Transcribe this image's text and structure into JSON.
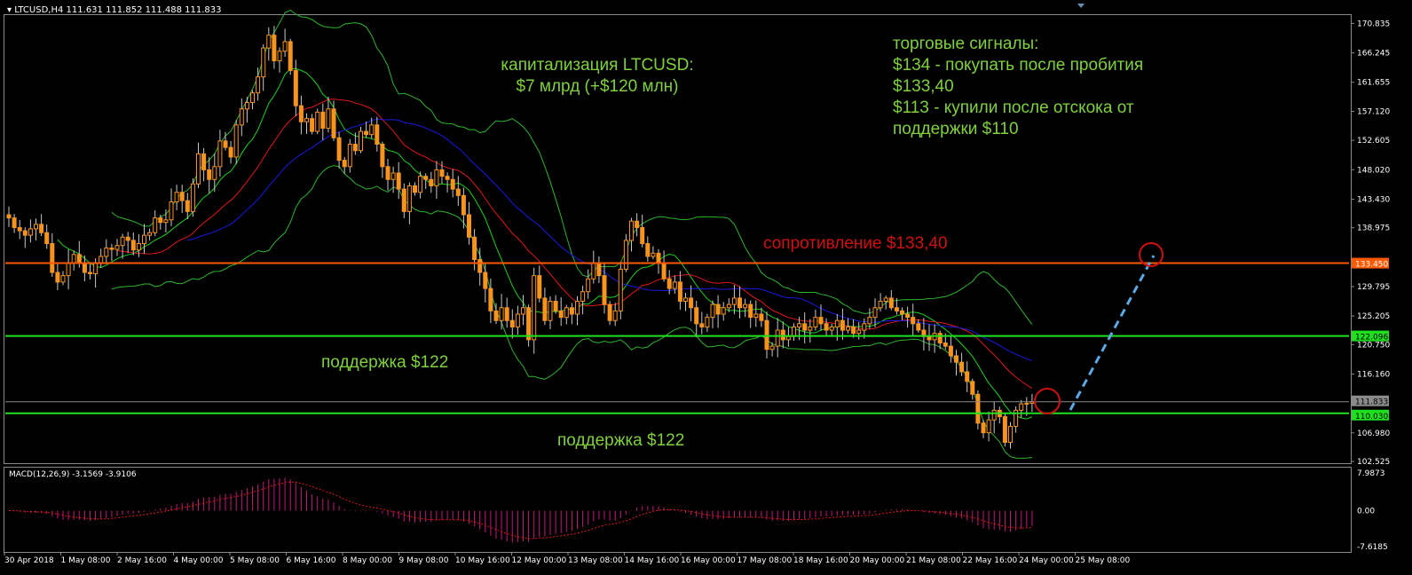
{
  "header": {
    "symbol": "LTCUSD,H4",
    "ohlc": "111.631 111.852 111.488 111.833"
  },
  "macd": {
    "label": "MACD(12,26,9) -3.1569 -3.9106",
    "axis": [
      "7.9873",
      "0.00",
      "-7.6185"
    ]
  },
  "annotations": {
    "cap_line1": "капитализация LTCUSD:",
    "cap_line2": "$7 млрд (+$120 млн)",
    "signals_title": "торговые сигналы:",
    "signal_1": "$134 - покупать после пробития",
    "signal_2": "$133,40",
    "signal_3": "$113 - купили после отскока от",
    "signal_4": "поддержки $110",
    "resistance": "сопротивление $133,40",
    "support_upper": "поддержка $122",
    "support_lower": "поддержка $122"
  },
  "colors": {
    "bull": "#f7941d",
    "bear": "#f7941d",
    "bollinger": "#2db52d",
    "ma_fast": "#1ad11a",
    "ma_mid": "#e01818",
    "ma_slow": "#1a1ae0",
    "resistance": "#ff5a00",
    "support": "#1fe01f",
    "macd_hist": "#c2187a",
    "macd_signal": "#e01818"
  },
  "chart_data": {
    "type": "candlestick",
    "symbol": "LTCUSD",
    "timeframe": "H4",
    "ylim": [
      102.525,
      172.0
    ],
    "y_ticks": [
      "170.835",
      "166.245",
      "161.655",
      "157.120",
      "152.605",
      "148.020",
      "143.430",
      "138.975",
      "129.795",
      "125.205",
      "120.750",
      "116.160",
      "106.980",
      "102.525"
    ],
    "x_ticks": [
      "30 Apr 2018",
      "1 May 08:00",
      "2 May 16:00",
      "4 May 00:00",
      "5 May 08:00",
      "6 May 16:00",
      "8 May 00:00",
      "9 May 08:00",
      "10 May 16:00",
      "12 May 00:00",
      "13 May 08:00",
      "14 May 16:00",
      "16 May 00:00",
      "17 May 08:00",
      "18 May 16:00",
      "20 May 00:00",
      "21 May 08:00",
      "22 May 16:00",
      "24 May 00:00",
      "25 May 08:00"
    ],
    "price_lines": [
      {
        "name": "resistance",
        "value": 133.45,
        "label": "133.450"
      },
      {
        "name": "support_upper",
        "value": 122.096,
        "label": "122.096"
      },
      {
        "name": "current",
        "value": 111.833,
        "label": "111.833"
      },
      {
        "name": "support_lower",
        "value": 110.03,
        "label": "110.030"
      }
    ],
    "close": [
      140.5,
      139.0,
      138.5,
      137.8,
      138.8,
      139.5,
      138.2,
      136.5,
      132.0,
      130.5,
      131.5,
      133.5,
      134.8,
      133.5,
      132.0,
      131.8,
      133.5,
      134.5,
      135.8,
      135.6,
      136.2,
      137.5,
      137.0,
      135.5,
      136.5,
      137.8,
      138.2,
      140.5,
      139.8,
      140.2,
      143.0,
      144.5,
      143.2,
      141.5,
      145.8,
      150.5,
      148.0,
      146.5,
      148.5,
      152.5,
      151.5,
      150.0,
      155.0,
      157.5,
      158.5,
      160.0,
      162.5,
      167.0,
      169.0,
      165.0,
      166.5,
      168.0,
      163.5,
      158.0,
      155.5,
      156.0,
      154.0,
      157.0,
      154.5,
      157.5,
      153.0,
      149.5,
      148.5,
      152.0,
      151.0,
      154.0,
      153.5,
      155.0,
      152.0,
      148.5,
      146.5,
      147.5,
      145.0,
      141.5,
      145.5,
      144.5,
      147.0,
      146.5,
      145.5,
      148.0,
      147.0,
      146.5,
      145.0,
      144.0,
      141.0,
      137.5,
      134.0,
      132.0,
      129.5,
      126.0,
      124.5,
      126.5,
      124.5,
      123.5,
      125.5,
      126.5,
      121.5,
      131.5,
      128.0,
      124.5,
      127.5,
      126.0,
      125.0,
      126.5,
      125.5,
      127.5,
      129.0,
      131.0,
      133.5,
      131.5,
      127.0,
      124.5,
      126.0,
      132.5,
      137.0,
      140.0,
      139.0,
      136.5,
      134.5,
      135.0,
      133.5,
      131.0,
      129.5,
      130.5,
      127.5,
      128.0,
      126.5,
      124.0,
      123.5,
      125.0,
      127.0,
      125.5,
      126.5,
      127.0,
      128.0,
      126.5,
      127.0,
      125.0,
      125.5,
      124.5,
      120.0,
      120.5,
      123.0,
      121.5,
      122.0,
      123.5,
      124.0,
      123.0,
      123.5,
      125.0,
      124.0,
      123.0,
      123.5,
      124.5,
      123.0,
      123.5,
      122.5,
      123.0,
      124.0,
      125.0,
      126.5,
      127.5,
      128.0,
      126.5,
      126.0,
      125.5,
      125.0,
      124.0,
      123.0,
      122.0,
      121.5,
      122.5,
      121.0,
      120.5,
      119.0,
      118.0,
      116.5,
      115.0,
      113.0,
      108.5,
      107.0,
      109.0,
      110.5,
      109.5,
      105.5,
      108.0,
      110.5,
      111.5,
      111.6,
      111.833
    ]
  }
}
